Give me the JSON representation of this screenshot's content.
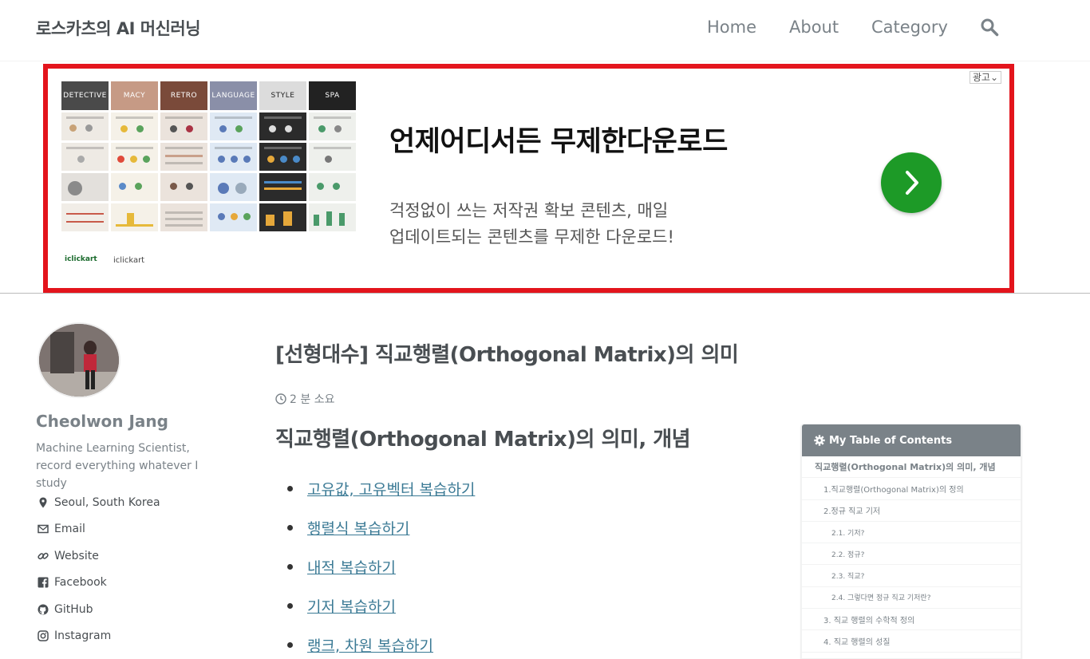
{
  "header": {
    "site_title": "로스카츠의 AI 머신러닝",
    "nav": [
      "Home",
      "About",
      "Category"
    ]
  },
  "ad": {
    "label": "광고",
    "thumb_titles": [
      "DETECTIVE",
      "MACY",
      "RETRO",
      "LANGUAGE",
      "STYLE",
      "SPA"
    ],
    "logo": "iclickart",
    "brand": "iclickart",
    "headline": "언제어디서든 무제한다운로드",
    "description_line1": "걱정없이 쓰는 저작권 확보 콘텐츠, 매일",
    "description_line2": "업데이트되는 콘텐츠를 무제한 다운로드!",
    "accent_color": "#1d9a27",
    "border_color": "#e3141c"
  },
  "author": {
    "name": "Cheolwon Jang",
    "bio": "Machine Learning Scientist, record everything whatever I study",
    "links": [
      {
        "icon": "map-marker-icon",
        "label": "Seoul, South Korea"
      },
      {
        "icon": "email-icon",
        "label": "Email"
      },
      {
        "icon": "link-icon",
        "label": "Website"
      },
      {
        "icon": "facebook-icon",
        "label": "Facebook"
      },
      {
        "icon": "github-icon",
        "label": "GitHub"
      },
      {
        "icon": "instagram-icon",
        "label": "Instagram"
      }
    ]
  },
  "post": {
    "title": "[선형대수] 직교행렬(Orthogonal Matrix)의 의미",
    "read_time": "2 분 소요",
    "section_heading": "직교행렬(Orthogonal Matrix)의 의미, 개념",
    "review_links": [
      "고유값, 고유벡터 복습하기",
      "행렬식 복습하기",
      "내적 복습하기",
      "기저 복습하기",
      "랭크, 차원 복습하기"
    ],
    "link_color": "#3b7a95"
  },
  "toc": {
    "title": "My Table of Contents",
    "items": [
      "직교행렬(Orthogonal Matrix)의 의미, 개념",
      "1.직교행렬(Orthogonal Matrix)의 정의",
      "2.정규 직교 기저",
      "2.1. 기저?",
      "2.2. 정규?",
      "2.3. 직교?",
      "2.4. 그렇다면 정규 직교 기저란?",
      "3. 직교 행렬의 수학적 정의",
      "4. 직교 행렬의 성질"
    ]
  }
}
